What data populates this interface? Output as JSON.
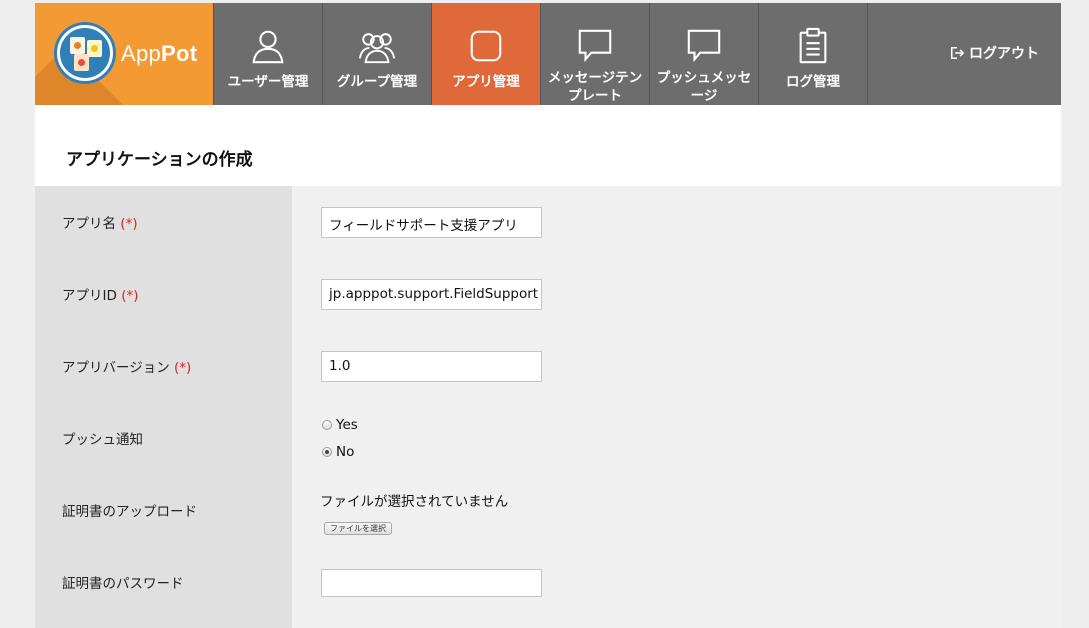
{
  "brand": {
    "name_light": "App",
    "name_bold": "Pot"
  },
  "nav": {
    "items": [
      {
        "label": "ユーザー管理",
        "icon": "user-icon",
        "active": false
      },
      {
        "label": "グループ管理",
        "icon": "group-icon",
        "active": false
      },
      {
        "label": "アプリ管理",
        "icon": "app-icon",
        "active": true
      },
      {
        "label": "メッセージテン\nプレート",
        "icon": "message-template-icon",
        "active": false
      },
      {
        "label": "プッシュメッセ\nージ",
        "icon": "push-message-icon",
        "active": false
      },
      {
        "label": "ログ管理",
        "icon": "log-icon",
        "active": false
      }
    ],
    "logout_label": "ログアウト"
  },
  "page": {
    "title": "アプリケーションの作成"
  },
  "form": {
    "required_mark": "(*)",
    "app_name": {
      "label": "アプリ名",
      "value": "フィールドサポート支援アプリ"
    },
    "app_id": {
      "label": "アプリID",
      "value": "jp.apppot.support.FieldSupport"
    },
    "app_version": {
      "label": "アプリバージョン",
      "value": "1.0"
    },
    "push": {
      "label": "プッシュ通知",
      "options": [
        "Yes",
        "No"
      ],
      "selected": "No"
    },
    "cert_upload": {
      "label": "証明書のアップロード",
      "status": "ファイルが選択されていません",
      "button_label": "ファイルを選択"
    },
    "cert_password": {
      "label": "証明書のパスワード",
      "value": ""
    }
  },
  "colors": {
    "brand_orange": "#f39a34",
    "active_tab": "#e0693a",
    "nav_bg": "#6d6d6d",
    "required": "#e02020"
  }
}
